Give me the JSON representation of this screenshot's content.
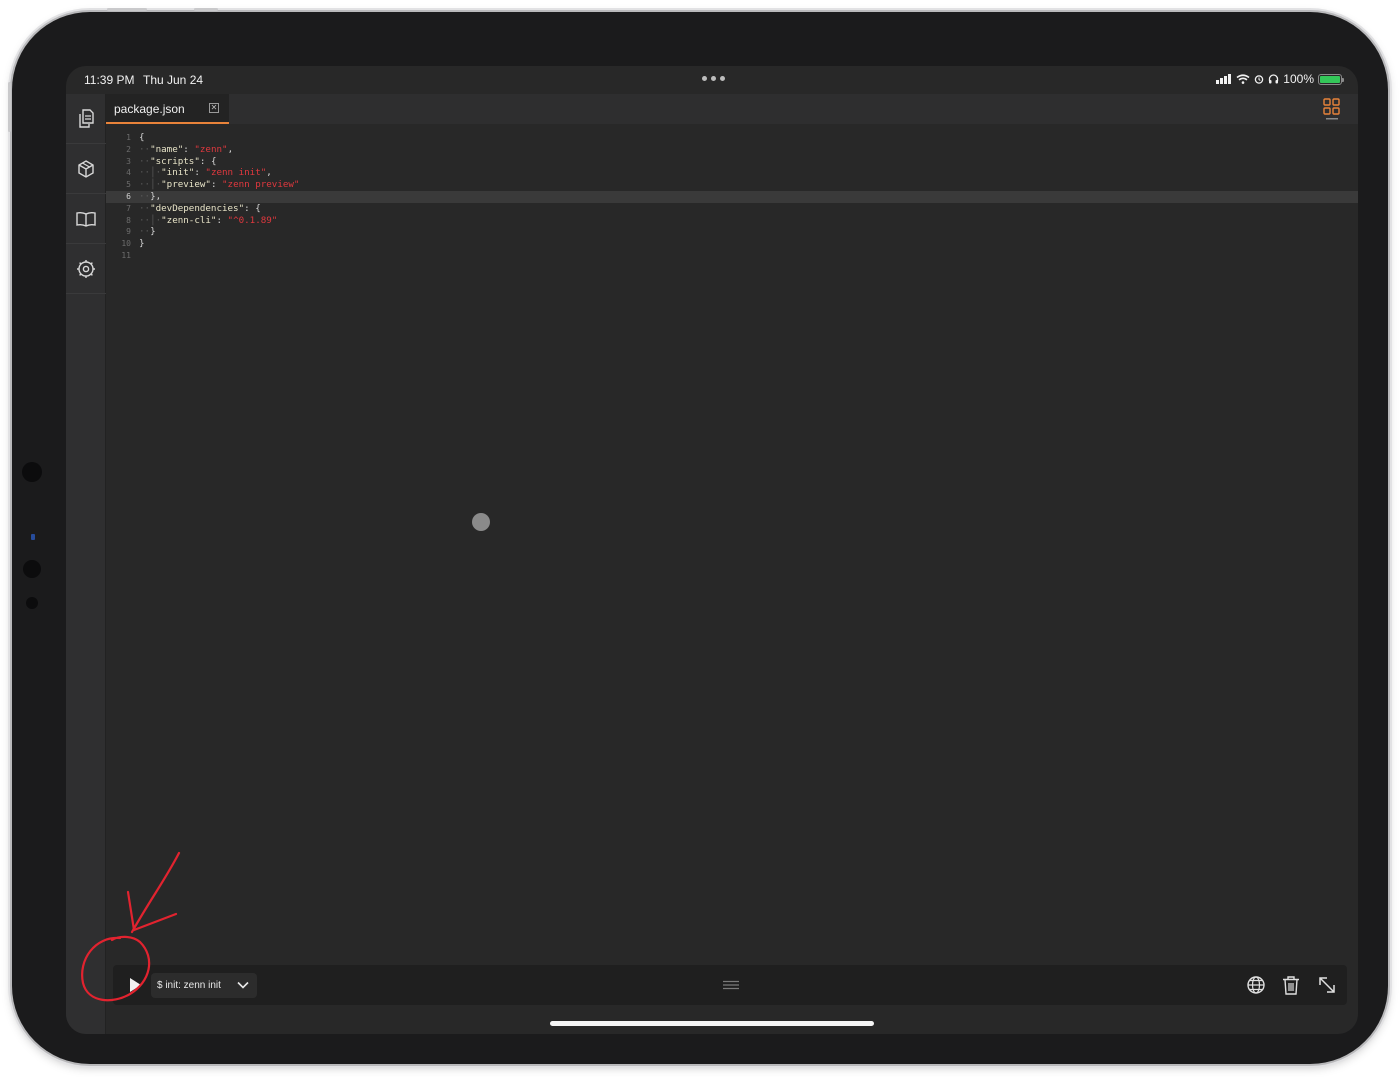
{
  "status_bar": {
    "time": "11:39 PM",
    "date": "Thu Jun 24",
    "battery": "100%"
  },
  "sidebar": {
    "items": [
      {
        "icon": "files-icon"
      },
      {
        "icon": "package-icon"
      },
      {
        "icon": "book-icon"
      },
      {
        "icon": "settings-icon"
      }
    ]
  },
  "tabs": [
    {
      "label": "package.json",
      "active": true
    }
  ],
  "editor": {
    "file": "package.json",
    "current_line": 6,
    "line_numbers": [
      "1",
      "2",
      "3",
      "4",
      "5",
      "6",
      "7",
      "8",
      "9",
      "10",
      "11"
    ],
    "lines": [
      [
        {
          "t": "{",
          "c": "p"
        }
      ],
      [
        {
          "t": "··",
          "c": "g"
        },
        {
          "t": "\"name\"",
          "c": "k"
        },
        {
          "t": ": ",
          "c": "p"
        },
        {
          "t": "\"zenn\"",
          "c": "s"
        },
        {
          "t": ",",
          "c": "p"
        }
      ],
      [
        {
          "t": "··",
          "c": "g"
        },
        {
          "t": "\"scripts\"",
          "c": "k"
        },
        {
          "t": ": {",
          "c": "p"
        }
      ],
      [
        {
          "t": "··│·",
          "c": "g"
        },
        {
          "t": "\"init\"",
          "c": "k"
        },
        {
          "t": ": ",
          "c": "p"
        },
        {
          "t": "\"zenn init\"",
          "c": "s"
        },
        {
          "t": ",",
          "c": "p"
        }
      ],
      [
        {
          "t": "··│·",
          "c": "g"
        },
        {
          "t": "\"preview\"",
          "c": "k"
        },
        {
          "t": ": ",
          "c": "p"
        },
        {
          "t": "\"zenn preview\"",
          "c": "s"
        }
      ],
      [
        {
          "t": "··",
          "c": "g"
        },
        {
          "t": "},",
          "c": "p"
        }
      ],
      [
        {
          "t": "··",
          "c": "g"
        },
        {
          "t": "\"devDependencies\"",
          "c": "k"
        },
        {
          "t": ": {",
          "c": "p"
        }
      ],
      [
        {
          "t": "··│·",
          "c": "g"
        },
        {
          "t": "\"zenn-cli\"",
          "c": "k"
        },
        {
          "t": ": ",
          "c": "p"
        },
        {
          "t": "\"^0.1.89\"",
          "c": "s"
        }
      ],
      [
        {
          "t": "··",
          "c": "g"
        },
        {
          "t": "}",
          "c": "p"
        }
      ],
      [
        {
          "t": "}",
          "c": "p"
        }
      ],
      []
    ]
  },
  "bottom_bar": {
    "task_label": "$ init: zenn init"
  },
  "colors": {
    "accent": "#e8833a",
    "string": "#e0383e",
    "annotation": "#e2232f"
  }
}
